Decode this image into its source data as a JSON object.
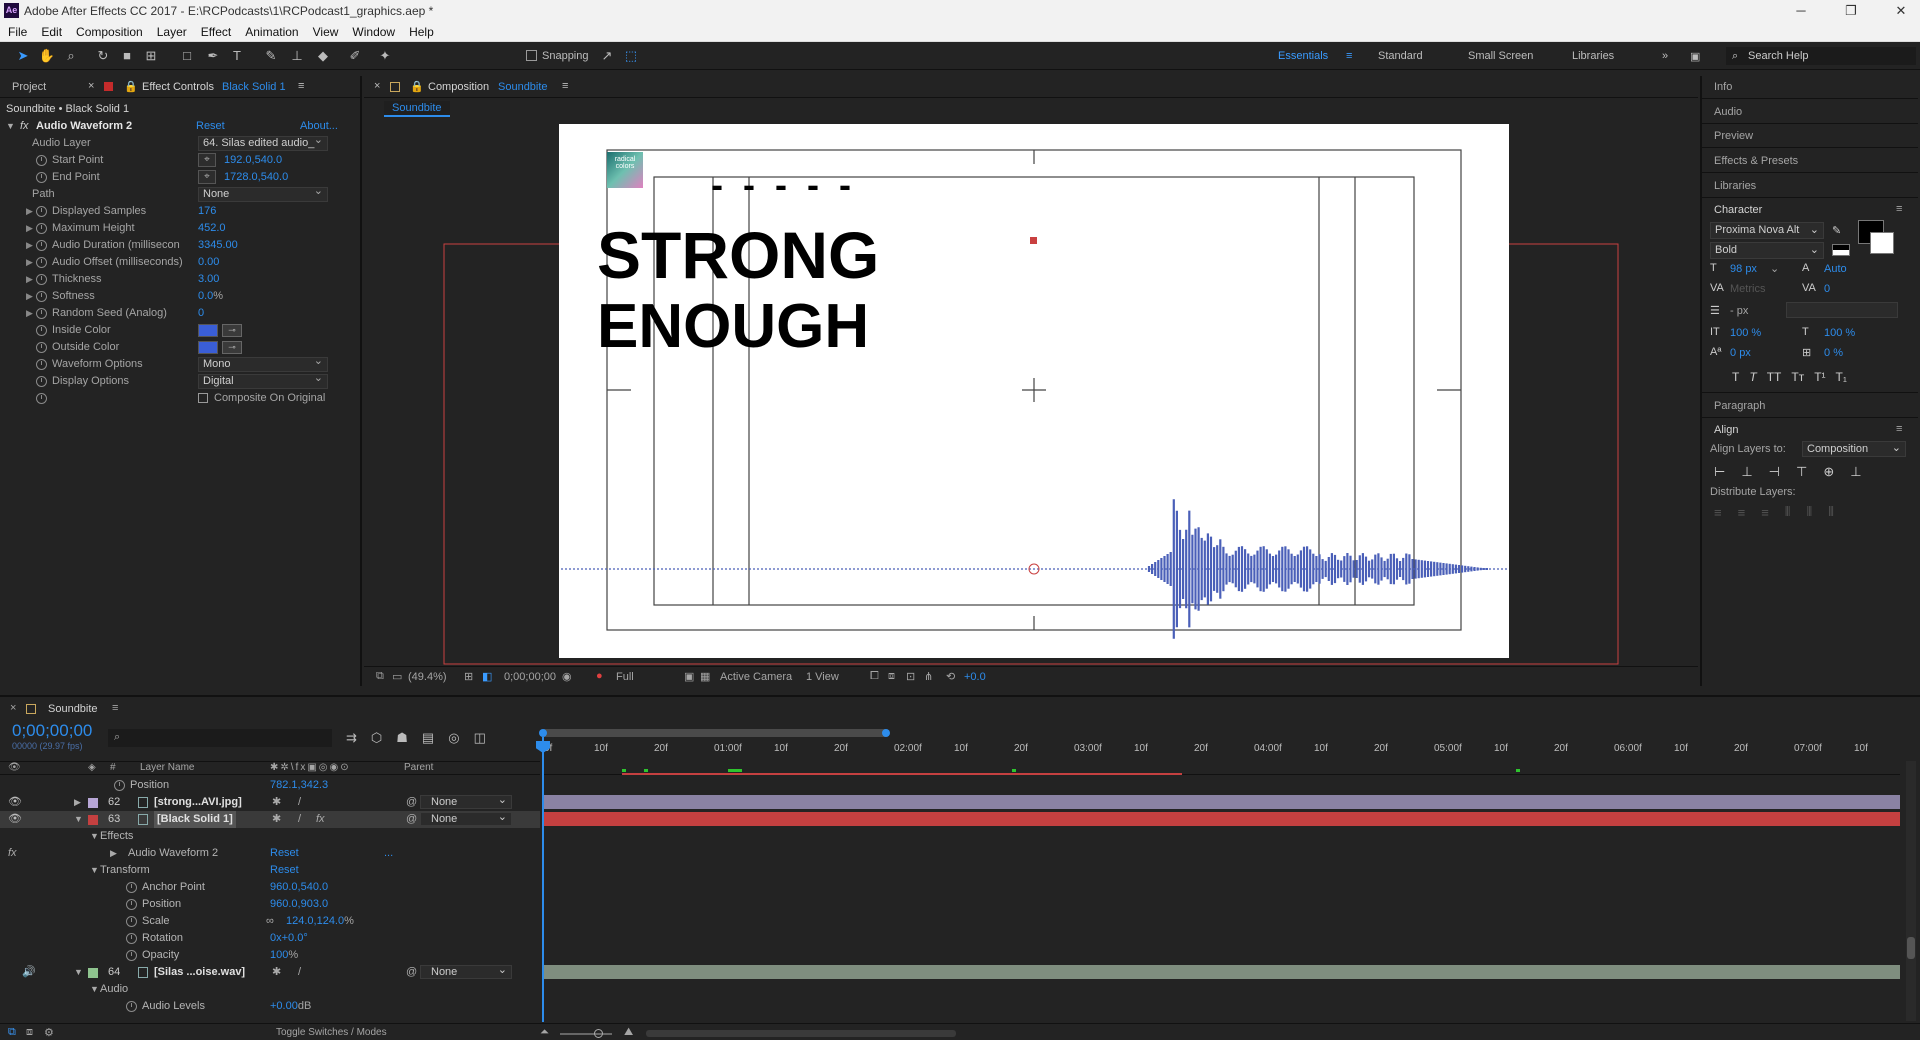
{
  "app": {
    "title": "Adobe After Effects CC 2017 - E:\\RCPodcasts\\1\\RCPodcast1_graphics.aep *",
    "icon": "Ae"
  },
  "menu": [
    "File",
    "Edit",
    "Composition",
    "Layer",
    "Effect",
    "Animation",
    "View",
    "Window",
    "Help"
  ],
  "toolbar": {
    "snapping": "Snapping",
    "workspaces": [
      "Essentials",
      "Standard",
      "Small Screen",
      "Libraries"
    ],
    "search": "Search Help"
  },
  "effect_panel": {
    "tab_project": "Project",
    "tab_effect": "Effect Controls",
    "tab_effect_layer": "Black Solid 1",
    "breadcrumb": "Soundbite • Black Solid 1",
    "effect_name": "Audio Waveform 2",
    "reset": "Reset",
    "about": "About...",
    "rows": [
      {
        "name": "Audio Layer",
        "value": "64. Silas edited audio_",
        "kind": "dropdown"
      },
      {
        "name": "Start Point",
        "value": "192.0,540.0",
        "kind": "point"
      },
      {
        "name": "End Point",
        "value": "1728.0,540.0",
        "kind": "point"
      },
      {
        "name": "Path",
        "value": "None",
        "kind": "dropdown"
      },
      {
        "name": "Displayed Samples",
        "value": "176",
        "kind": "num"
      },
      {
        "name": "Maximum Height",
        "value": "452.0",
        "kind": "num"
      },
      {
        "name": "Audio Duration (millisecon",
        "value": "3345.00",
        "kind": "num"
      },
      {
        "name": "Audio Offset (milliseconds)",
        "value": "0.00",
        "kind": "num"
      },
      {
        "name": "Thickness",
        "value": "3.00",
        "kind": "num"
      },
      {
        "name": "Softness",
        "value": "0.0",
        "unit": "%",
        "kind": "num"
      },
      {
        "name": "Random Seed (Analog)",
        "value": "0",
        "kind": "num"
      },
      {
        "name": "Inside Color",
        "value": "",
        "kind": "color"
      },
      {
        "name": "Outside Color",
        "value": "",
        "kind": "color"
      },
      {
        "name": "Waveform Options",
        "value": "Mono",
        "kind": "dropdown"
      },
      {
        "name": "Display Options",
        "value": "Digital",
        "kind": "dropdown"
      },
      {
        "name": "",
        "value": "Composite On Original",
        "kind": "checkbox"
      }
    ]
  },
  "comp_panel": {
    "tab": "Composition",
    "comp_name": "Soundbite",
    "subtab": "Soundbite",
    "text_line1": "STRONG",
    "text_line2": "ENOUGH",
    "dashes": "- - - - -",
    "logo": "radical colors",
    "footer": {
      "zoom": "(49.4%)",
      "time": "0;00;00;00",
      "quality": "Full",
      "camera": "Active Camera",
      "views": "1 View",
      "exposure": "+0.0"
    }
  },
  "right_panel": {
    "items": [
      "Info",
      "Audio",
      "Preview",
      "Effects & Presets",
      "Libraries"
    ],
    "character": {
      "title": "Character",
      "font": "Proxima Nova Alt",
      "style": "Bold",
      "size": "98",
      "size_unit": "px",
      "leading": "Auto",
      "kerning": "Metrics",
      "tracking": "0",
      "stroke_unit": "px",
      "vscale": "100",
      "hscale": "100",
      "baseline": "0",
      "baseline_unit": "px",
      "tsume": "0",
      "pct": "%"
    },
    "paragraph": "Paragraph",
    "align": {
      "title": "Align",
      "layers_to": "Align Layers to:",
      "target": "Composition",
      "distribute": "Distribute Layers:"
    }
  },
  "timeline": {
    "tab": "Soundbite",
    "timecode": "0;00;00;00",
    "subcode": "00000 (29.97 fps)",
    "headers": {
      "layer_name": "Layer Name",
      "parent": "Parent",
      "num": "#"
    },
    "ruler": [
      "0f",
      "10f",
      "20f",
      "01:00f",
      "10f",
      "20f",
      "02:00f",
      "10f",
      "20f",
      "03:00f",
      "10f",
      "20f",
      "04:00f",
      "10f",
      "20f",
      "05:00f",
      "10f",
      "20f",
      "06:00f",
      "10f",
      "20f",
      "07:00f",
      "10f"
    ],
    "rows": [
      {
        "type": "prop",
        "name": "Position",
        "value": "782.1,342.3",
        "indent": 130
      },
      {
        "type": "layer",
        "num": "62",
        "name": "[strong...AVI.jpg]",
        "parent": "None",
        "color": "#b7a6d6"
      },
      {
        "type": "layer",
        "num": "63",
        "name": "[Black Solid 1]",
        "parent": "None",
        "color": "#c44040",
        "selected": true
      },
      {
        "type": "group",
        "name": "Effects",
        "indent": 100
      },
      {
        "type": "prop",
        "name": "Audio Waveform 2",
        "value": "Reset",
        "extra": "...",
        "indent": 128
      },
      {
        "type": "group",
        "name": "Transform",
        "value": "Reset",
        "indent": 100
      },
      {
        "type": "prop",
        "name": "Anchor Point",
        "value": "960.0,540.0",
        "indent": 142
      },
      {
        "type": "prop",
        "name": "Position",
        "value": "960.0,903.0",
        "indent": 142
      },
      {
        "type": "prop",
        "name": "Scale",
        "value": "124.0,124.0",
        "unit": "%",
        "indent": 142
      },
      {
        "type": "prop",
        "name": "Rotation",
        "value": "0x+0.0°",
        "indent": 142
      },
      {
        "type": "prop",
        "name": "Opacity",
        "value": "100",
        "unit": "%",
        "indent": 142
      },
      {
        "type": "layer",
        "num": "64",
        "name": "[Silas ...oise.wav]",
        "parent": "None",
        "color": "#8fc48f"
      },
      {
        "type": "group",
        "name": "Audio",
        "indent": 100
      },
      {
        "type": "prop",
        "name": "Audio Levels",
        "value": "+0.00",
        "unit": "dB",
        "indent": 142
      }
    ],
    "toggle": "Toggle Switches / Modes"
  },
  "colors": {
    "accent": "#2d8ceb",
    "bg": "#232323",
    "solid_bar": "#c44040",
    "jpg_bar": "#8a82a3",
    "wav_bar": "#7f8e7f",
    "wave": "#4a5fb8"
  }
}
